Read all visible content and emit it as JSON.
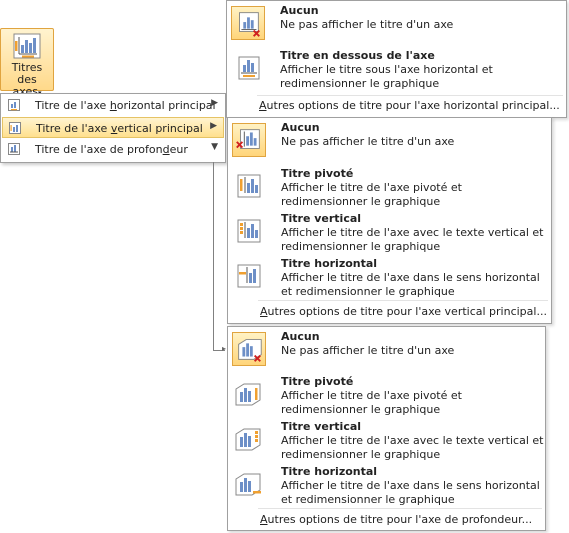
{
  "ribbon_button": {
    "label_line1": "Titres des",
    "label_line2": "axes",
    "caret": "▾",
    "icon": "axis-titles-icon"
  },
  "submenu": {
    "items": [
      {
        "pre": "Titre de l'axe ",
        "acc": "h",
        "post": "orizontal principal",
        "arrow": "▶"
      },
      {
        "pre": "Titre de l'axe ",
        "acc": "v",
        "post": "ertical principal",
        "arrow": "▶"
      },
      {
        "pre": "Titre de l'axe de profon",
        "acc": "d",
        "post": "eur",
        "arrow": "▼"
      }
    ]
  },
  "horizontal_gallery": {
    "options": [
      {
        "title": "Aucun",
        "desc": "Ne pas afficher le titre d'un axe",
        "icon": "no-title-icon"
      },
      {
        "title": "Titre en dessous de l'axe",
        "desc": "Afficher le titre sous l'axe horizontal et redimensionner le graphique",
        "icon": "title-below-axis-icon"
      }
    ],
    "more": {
      "acc": "A",
      "rest": "utres options de titre pour l'axe horizontal principal..."
    }
  },
  "vertical_gallery": {
    "options": [
      {
        "title": "Aucun",
        "desc": "Ne pas afficher le titre d'un axe",
        "icon": "no-title-icon"
      },
      {
        "title": "Titre pivoté",
        "desc": "Afficher le titre de l'axe pivoté et redimensionner le graphique",
        "icon": "rotated-title-icon"
      },
      {
        "title": "Titre vertical",
        "desc": "Afficher le titre de l'axe avec le texte vertical et redimensionner le graphique",
        "icon": "vertical-title-icon"
      },
      {
        "title": "Titre horizontal",
        "desc": "Afficher le titre de l'axe dans le sens horizontal et redimensionner le graphique",
        "icon": "horizontal-title-icon"
      }
    ],
    "more": {
      "acc": "A",
      "rest": "utres options de titre pour l'axe vertical principal..."
    }
  },
  "depth_gallery": {
    "options": [
      {
        "title": "Aucun",
        "desc": "Ne pas afficher le titre d'un axe",
        "icon": "no-title-3d-icon"
      },
      {
        "title": "Titre pivoté",
        "desc": "Afficher le titre de l'axe pivoté et redimensionner le graphique",
        "icon": "rotated-title-3d-icon"
      },
      {
        "title": "Titre vertical",
        "desc": "Afficher le titre de l'axe avec le texte vertical et redimensionner le graphique",
        "icon": "vertical-title-3d-icon"
      },
      {
        "title": "Titre horizontal",
        "desc": "Afficher le titre de l'axe dans le sens horizontal et redimensionner le graphique",
        "icon": "horizontal-title-3d-icon"
      }
    ],
    "more": {
      "acc": "A",
      "rest": "utres options de titre pour l'axe de profondeur..."
    }
  }
}
